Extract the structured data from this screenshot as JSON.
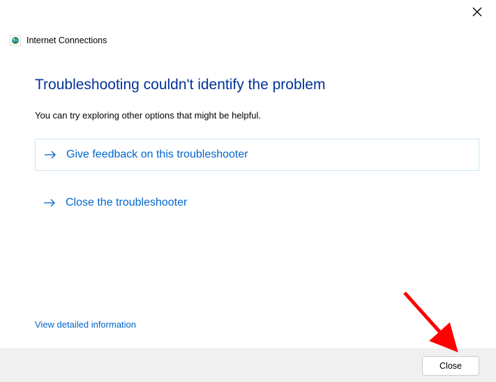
{
  "header": {
    "title": "Internet Connections"
  },
  "main": {
    "heading": "Troubleshooting couldn't identify the problem",
    "subtext": "You can try exploring other options that might be helpful.",
    "options": [
      {
        "label": "Give feedback on this troubleshooter"
      },
      {
        "label": "Close the troubleshooter"
      }
    ]
  },
  "detailed_link": "View detailed information",
  "footer": {
    "close_label": "Close"
  }
}
